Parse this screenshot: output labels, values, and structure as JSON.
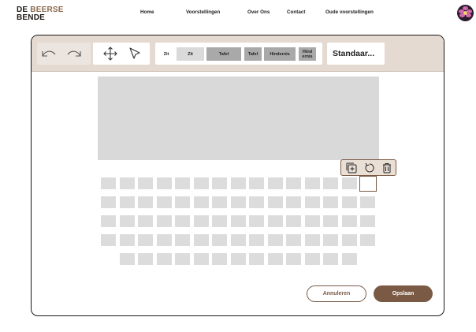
{
  "brand": {
    "line1_a": "DE ",
    "line1_b": "BEERSE",
    "line2": "BENDE"
  },
  "nav": {
    "items": [
      "Home",
      "Voorstellingen",
      "Over Ons",
      "Contact",
      "Oude voorstellingen"
    ]
  },
  "toolbar": {
    "undo_icon": "undo-icon",
    "redo_icon": "redo-icon",
    "move_icon": "move-icon",
    "select_icon": "pointer-icon",
    "types": [
      {
        "label": "Zit",
        "color": "#dadada"
      },
      {
        "label": "Zit",
        "color": "#dadada"
      },
      {
        "label": "Tafel",
        "color": "#a9a9a9"
      },
      {
        "label": "Tafel",
        "color": "#a9a9a9"
      },
      {
        "label": "Hindernis",
        "color": "#a9a9a9"
      },
      {
        "label": "Hind ernis",
        "color": "#a9a9a9"
      }
    ],
    "mode_label": "Standaar..."
  },
  "selection_toolbar": {
    "icons": [
      "duplicate-icon",
      "rotate-icon",
      "delete-icon"
    ]
  },
  "actions": {
    "cancel": "Annuleren",
    "save": "Opslaan"
  },
  "colors": {
    "accent": "#7a5a45",
    "toolbar_bg": "#e5dad1",
    "seat": "#dcdcdc",
    "stage": "#d9d9d9"
  }
}
